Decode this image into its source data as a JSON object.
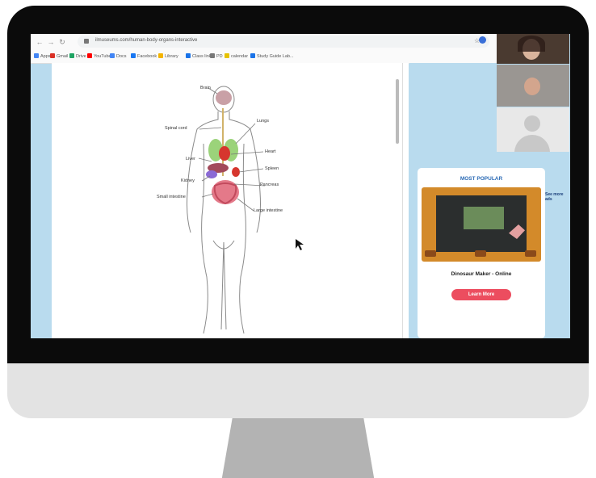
{
  "browser": {
    "url": "ilmuseums.com/human-body-organs-interactive",
    "bookmarks": [
      {
        "label": "Apps",
        "color": "#4285f4"
      },
      {
        "label": "Gmail",
        "color": "#d93025"
      },
      {
        "label": "Drive",
        "color": "#1fa463"
      },
      {
        "label": "YouTube",
        "color": "#ff0000"
      },
      {
        "label": "Docs",
        "color": "#4285f4"
      },
      {
        "label": "Facebook",
        "color": "#1877f2"
      },
      {
        "label": "Library",
        "color": "#f4b400"
      },
      {
        "label": "Class links",
        "color": "#1a73e8"
      },
      {
        "label": "PD",
        "color": "#777777"
      },
      {
        "label": "calendar",
        "color": "#e6c200"
      },
      {
        "label": "Study Guide Lab...",
        "color": "#1a73e8"
      }
    ]
  },
  "diagram": {
    "labels": {
      "brain": "Brain",
      "spinal_cord": "Spinal cord",
      "lungs": "Lungs",
      "liver": "Liver",
      "heart": "Heart",
      "spleen": "Spleen",
      "kidney": "Kidney",
      "pancreas": "Pancreas",
      "small_intestine": "Small intestine",
      "large_intestine": "Large intestine"
    }
  },
  "sidebar": {
    "see_all": "See more ads",
    "most_popular_title": "MOST POPULAR",
    "game_title": "Dinosaur Maker - Online",
    "learn_more": "Learn More"
  },
  "colors": {
    "accent_blue": "#2a6ab5",
    "button_red": "#ec4d5f",
    "panel_blue": "#b9dbee"
  }
}
